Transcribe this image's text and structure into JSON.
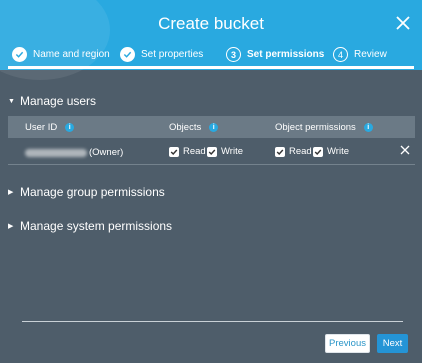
{
  "dialog": {
    "title": "Create bucket"
  },
  "steps": [
    {
      "number": "",
      "label": "Name and region",
      "state": "done"
    },
    {
      "number": "",
      "label": "Set properties",
      "state": "done"
    },
    {
      "number": "3",
      "label": "Set permissions",
      "state": "current"
    },
    {
      "number": "4",
      "label": "Review",
      "state": "todo"
    }
  ],
  "sections": {
    "manage_users": "Manage users",
    "manage_group": "Manage group permissions",
    "manage_system": "Manage system permissions"
  },
  "table": {
    "headers": {
      "user_id": "User ID",
      "objects": "Objects",
      "object_permissions": "Object permissions"
    },
    "info_glyph": "i",
    "row": {
      "owner_suffix": "(Owner)",
      "objects": {
        "read": "Read",
        "write": "Write",
        "read_checked": true,
        "write_checked": true
      },
      "object_permissions": {
        "read": "Read",
        "write": "Write",
        "read_checked": true,
        "write_checked": true
      }
    }
  },
  "buttons": {
    "previous": "Previous",
    "next": "Next"
  },
  "colors": {
    "header": "#29a9e0",
    "body": "#4e5d6a",
    "primary_button": "#2494d6"
  }
}
